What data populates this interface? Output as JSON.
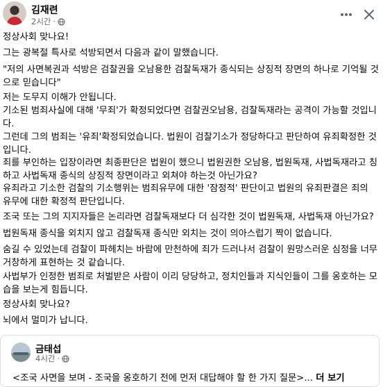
{
  "post": {
    "author": "김재련",
    "time": "2시간",
    "meta_sep": "·",
    "icons": {
      "privacy": "globe-icon",
      "more": "more-horizontal-icon",
      "close": "close-icon"
    },
    "paragraphs": [
      [
        "정상사회 맞나요!"
      ],
      [
        "그는 광복절 특사로 석방되면서 다음과 같이 말했습니다."
      ],
      [
        "\"저의 사면복권과 석방은 검찰권을 오남용한 검찰독재가 종식되는 상징적 장면의 하나로 기억될 것",
        "으로 믿습니다\""
      ],
      [
        "저는 도무지 이해가 안됩니다.",
        "기소된 범죄사실에 대해 '무죄'가 확정되었다면 검찰권오남용, 검찰독재라는 공격이 가능할 것입니",
        "다."
      ],
      [
        "그런데 그의 범죄는 '유죄'확정되었습니다. 법원이 검찰기소가 정당하다고 판단하여 유죄확정한 것",
        "입니다."
      ],
      [
        "죄를 부인하는 입장이라면 최종판단은 법원이 했으니 법원권한 오남용, 법원독재, 사법독재라고 칭",
        "하고 사법독재 종식의 상징적 장면이라고 외쳐야 하는것 아닌가요?"
      ],
      [
        "유죄라고 기소한 검찰의 기소행위는 범죄유무에 대한 '잠정적' 판단이고  법원의 유죄판결은 죄의",
        "유무에 대한 확정적 판단입니다."
      ],
      [
        "조국 또는 그의 지지자들은 논리라면 검찰독재보다 더 심각한 것이 법원독재, 사법독재 아닌가요?"
      ],
      [
        "법원독재 종식을 외치지 않고 검찰독재 종식만 외치는 것이 의아스럽기 짝이 없습니다."
      ],
      [
        "숨길 수 있었는데 검찰이 파헤치는 바람에 만천하에 죄가 드러나서 검찰이 원망스러운 심정을 너무",
        "거창하게 표현하는 것 같습니다."
      ],
      [
        "사법부가 인정한 범죄로 처벌받은 사람이 이리 당당하고, 정치인들과 지식인들이 그를 옹호하는 모",
        "습을 보는게 힘듭니다."
      ],
      [
        "정상사회 맞나요?"
      ],
      [
        "뇌에서 멀미가 납니다."
      ]
    ]
  },
  "shared_post": {
    "author": "금태섭",
    "time": "4시간",
    "meta_sep": "·",
    "text": "<조국 사면을 보며 - 조국을 옹호하기 전에 먼저 대답해야 할 한 가지 질문>...",
    "see_more": "더 보기",
    "icons": {
      "privacy": "globe-icon"
    }
  }
}
